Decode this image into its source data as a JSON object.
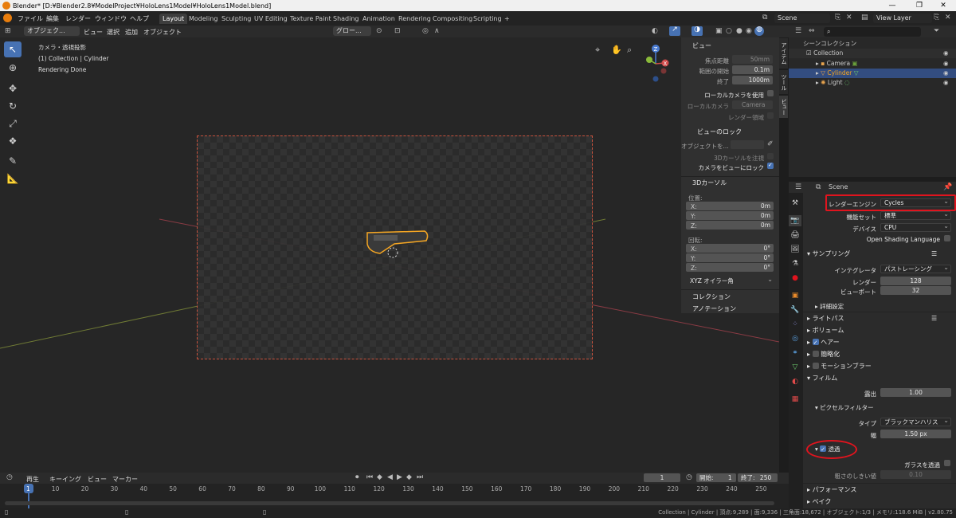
{
  "window": {
    "title": "Blender* [D:¥Blender2.8¥ModelProject¥HoloLens1Model¥HoloLens1Model.blend]"
  },
  "menus": [
    "ファイル",
    "編集",
    "レンダー",
    "ウィンドウ",
    "ヘルプ"
  ],
  "workspaces": [
    "Layout",
    "Modeling",
    "Sculpting",
    "UV Editing",
    "Texture Paint",
    "Shading",
    "Animation",
    "Rendering",
    "Compositing",
    "Scripting"
  ],
  "scene_name": "Scene",
  "view_layer": "View Layer",
  "viewport_header": {
    "mode": "オブジェク...",
    "menus": [
      "ビュー",
      "選択",
      "追加",
      "オブジェクト"
    ],
    "transform": "グロー..."
  },
  "overlay_text": [
    "カメラ・透視投影",
    "(1) Collection | Cylinder",
    "Rendering Done"
  ],
  "npanel": {
    "tabs": [
      "アイテム",
      "ツール",
      "ビュー"
    ],
    "view_title": "ビュー",
    "focal_label": "焦点距離",
    "focal": "50mm",
    "clip_start_label": "範囲の開始",
    "clip_start": "0.1m",
    "clip_end_label": "終了",
    "clip_end": "1000m",
    "local_camera_use": "ローカルカメラを使用",
    "local_camera_label": "ローカルカメラ",
    "local_camera": "Camera",
    "render_region": "レンダー領域",
    "lock_title": "ビューのロック",
    "lock_object_label": "オブジェクトを...",
    "lock_cursor": "3Dカーソルを注視",
    "lock_camera": "カメラをビューにロック",
    "cursor_title": "3Dカーソル",
    "location": "位置:",
    "x": "X:",
    "y": "Y:",
    "z": "Z:",
    "loc_x": "0m",
    "loc_y": "0m",
    "loc_z": "0m",
    "rotation": "回転:",
    "rot_x": "0°",
    "rot_y": "0°",
    "rot_z": "0°",
    "rot_mode": "XYZ オイラー角",
    "collection": "コレクション",
    "annotation": "アノテーション"
  },
  "outliner": {
    "scene_collection": "シーンコレクション",
    "collection": "Collection",
    "items": [
      "Camera",
      "Cylinder",
      "Light"
    ]
  },
  "properties": {
    "context": "Scene",
    "render_engine_label": "レンダーエンジン",
    "render_engine": "Cycles",
    "feature_set_label": "機能セット",
    "feature_set": "標準",
    "device_label": "デバイス",
    "device": "CPU",
    "open_shading": "Open Shading Language",
    "sampling": "サンプリング",
    "integrator_label": "インテグレータ",
    "integrator": "パストレーシング",
    "render_label": "レンダー",
    "render_samples": "128",
    "viewport_label": "ビューポート",
    "viewport_samples": "32",
    "advanced": "詳細設定",
    "light_paths": "ライトパス",
    "volumes": "ボリューム",
    "hair": "ヘアー",
    "simplify": "簡略化",
    "motion_blur": "モーションブラー",
    "film": "フィルム",
    "exposure_label": "露出",
    "exposure": "1.00",
    "pixel_filter": "ピクセルフィルター",
    "type_label": "タイプ",
    "type": "ブラックマンハリス",
    "width_label": "幅",
    "width": "1.50 px",
    "transparent": "透過",
    "transparent_glass": "ガラスを透過",
    "roughness_label": "粗さのしきい値",
    "roughness": "0.10",
    "performance": "パフォーマンス",
    "bake": "ベイク"
  },
  "timeline": {
    "menus": [
      "再生",
      "キーイング",
      "ビュー",
      "マーカー"
    ],
    "current_frame": "1",
    "start_label": "開始:",
    "start": "1",
    "end_label": "終了:",
    "end": "250",
    "ticks": [
      "1",
      "10",
      "20",
      "30",
      "40",
      "50",
      "60",
      "70",
      "80",
      "90",
      "100",
      "110",
      "120",
      "130",
      "140",
      "150",
      "160",
      "170",
      "180",
      "190",
      "200",
      "210",
      "220",
      "230",
      "240",
      "250"
    ]
  },
  "status": "Collection | Cylinder | 頂点:9,289 | 面:9,336 | 三角面:18,672 | オブジェクト:1/3 | メモリ:118.6 MiB | v2.80.75",
  "colors": {
    "accent": "#4772b3",
    "selection": "#f5a623",
    "highlight": "#e0141e"
  }
}
